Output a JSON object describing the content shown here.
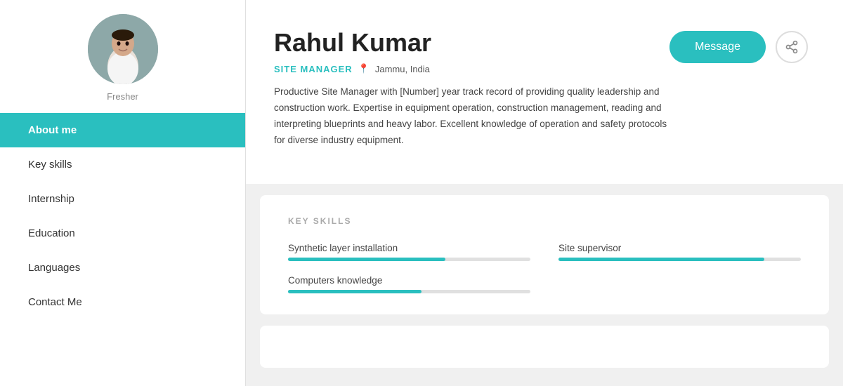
{
  "sidebar": {
    "fresher_label": "Fresher",
    "nav_items": [
      {
        "label": "About me",
        "active": true
      },
      {
        "label": "Key skills",
        "active": false
      },
      {
        "label": "Internship",
        "active": false
      },
      {
        "label": "Education",
        "active": false
      },
      {
        "label": "Languages",
        "active": false
      },
      {
        "label": "Contact Me",
        "active": false
      }
    ]
  },
  "profile": {
    "name": "Rahul Kumar",
    "title": "SITE MANAGER",
    "location": "Jammu, India",
    "bio": "Productive Site Manager with [Number] year track record of providing quality leadership and construction work. Expertise in equipment operation, construction management, reading and interpreting blueprints and heavy labor. Excellent knowledge of operation and safety protocols for diverse industry equipment.",
    "message_btn": "Message",
    "share_icon": "share"
  },
  "skills_section": {
    "title": "KEY SKILLS",
    "skills": [
      {
        "name": "Synthetic layer installation",
        "percent": 65
      },
      {
        "name": "Site supervisor",
        "percent": 85
      },
      {
        "name": "Computers knowledge",
        "percent": 55
      }
    ]
  }
}
